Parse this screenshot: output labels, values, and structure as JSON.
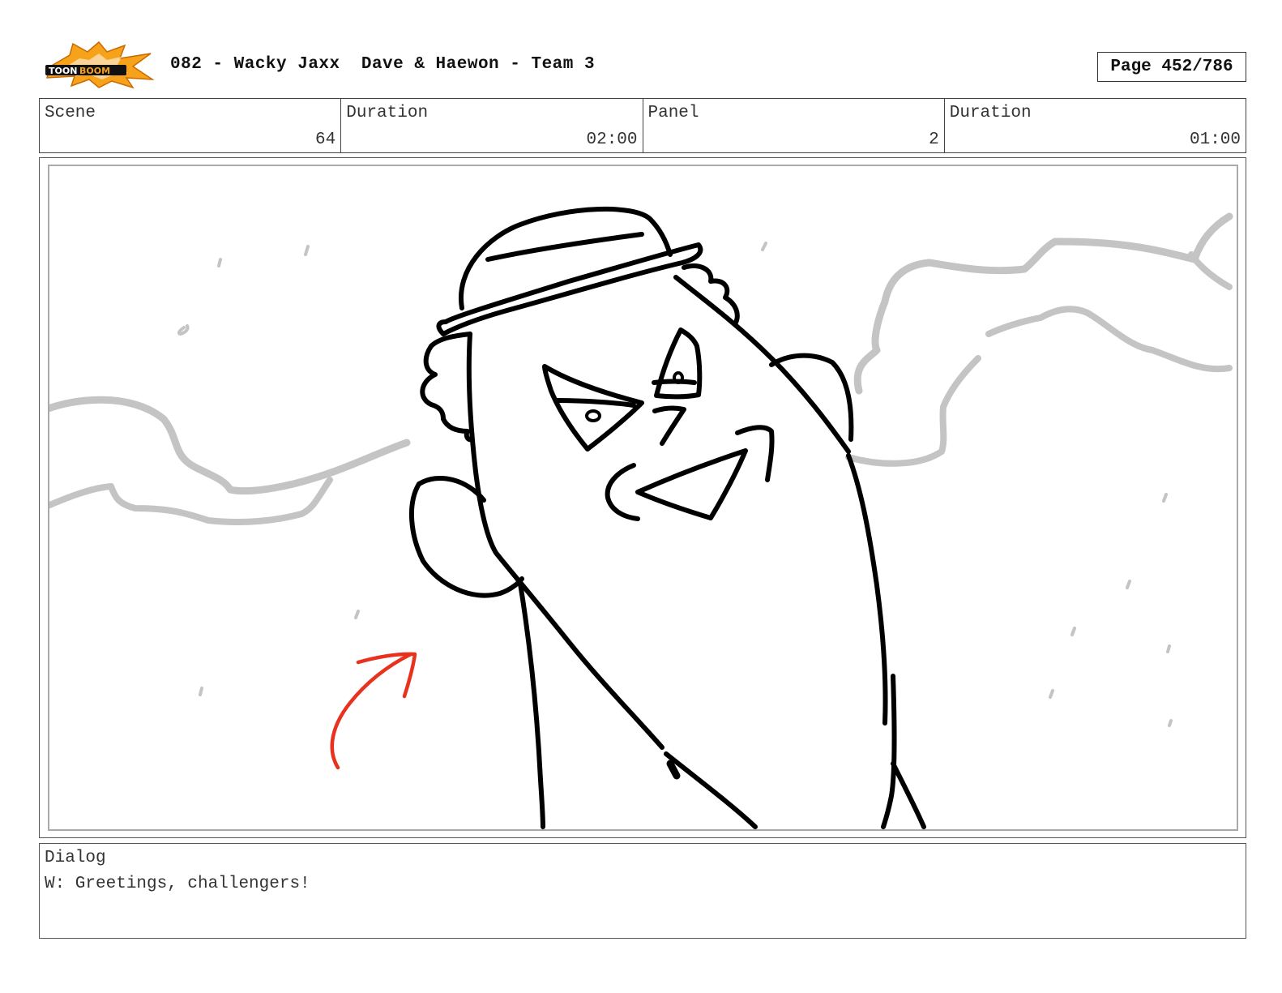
{
  "header": {
    "logo_icon": "toonboom-logo",
    "title": "082 - Wacky Jaxx  Dave & Haewon - Team 3",
    "page_label": "Page 452/786"
  },
  "info": {
    "scene_label": "Scene",
    "scene_value": "64",
    "scene_duration_label": "Duration",
    "scene_duration_value": "02:00",
    "panel_label": "Panel",
    "panel_value": "2",
    "panel_duration_label": "Duration",
    "panel_duration_value": "01:00"
  },
  "panel": {
    "icons": [
      "character-sketch",
      "cloud-sketch",
      "motion-arrow-icon"
    ],
    "arrow_color": "#e8321e"
  },
  "dialog": {
    "label": "Dialog",
    "text": "W: Greetings, challengers!"
  }
}
